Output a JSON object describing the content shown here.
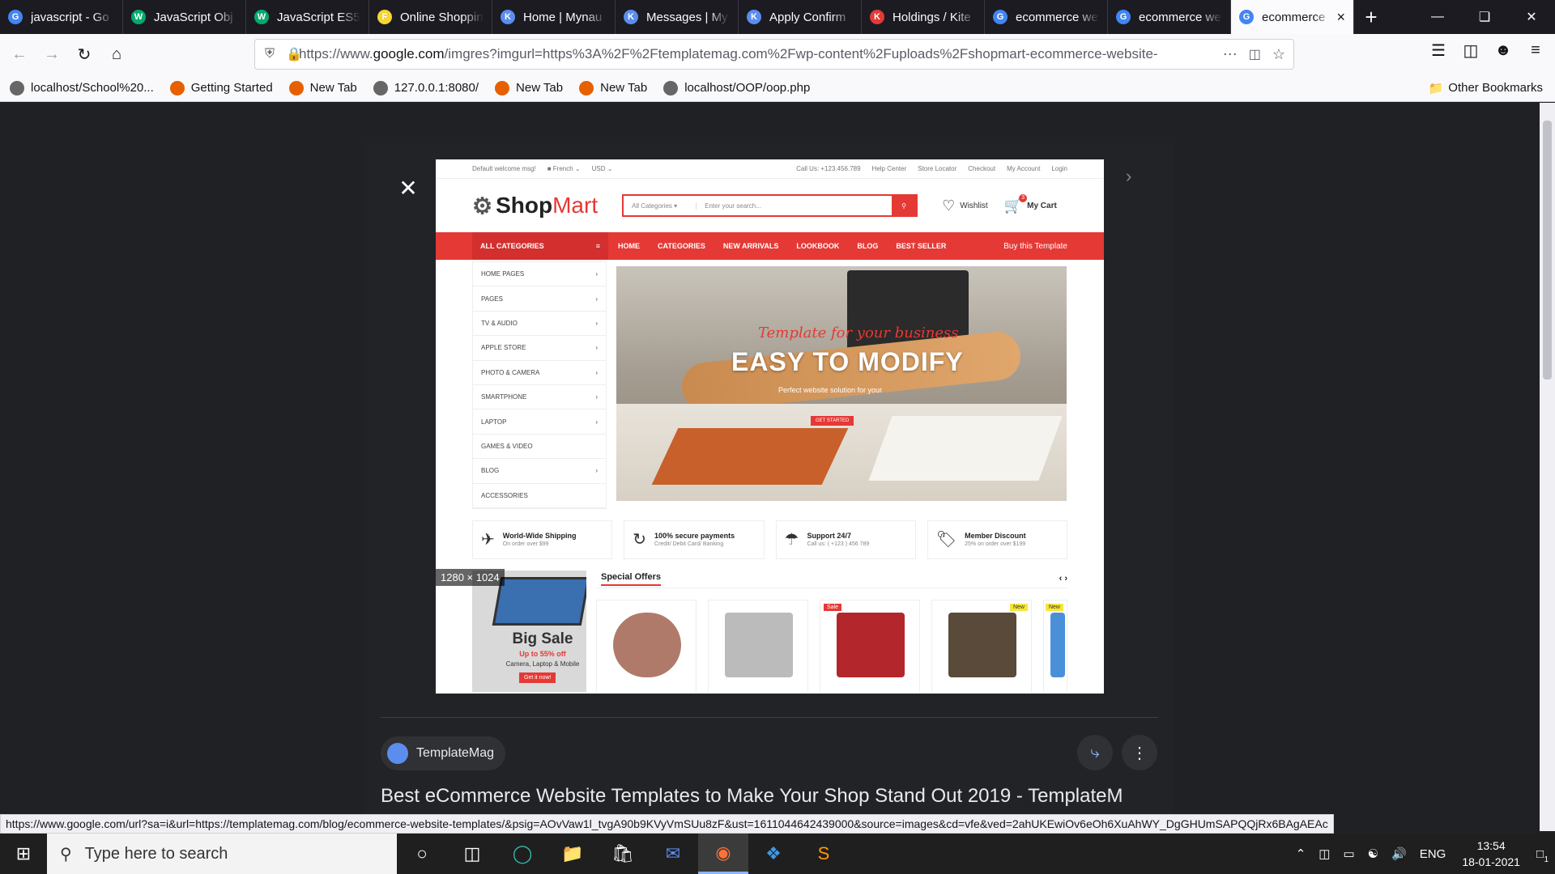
{
  "tabs": [
    {
      "title": "javascript - Go",
      "fav_color": "#4285f4",
      "fav_glyph": "G"
    },
    {
      "title": "JavaScript Obj",
      "fav_color": "#04aa6d",
      "fav_glyph": "W"
    },
    {
      "title": "JavaScript ES5",
      "fav_color": "#04aa6d",
      "fav_glyph": "W"
    },
    {
      "title": "Online Shoppin",
      "fav_color": "#f7d633",
      "fav_glyph": "F"
    },
    {
      "title": "Home | Mynau",
      "fav_color": "#5b8def",
      "fav_glyph": "K"
    },
    {
      "title": "Messages | My",
      "fav_color": "#5b8def",
      "fav_glyph": "K"
    },
    {
      "title": "Apply Confirm",
      "fav_color": "#5b8def",
      "fav_glyph": "K"
    },
    {
      "title": "Holdings / Kite",
      "fav_color": "#e53935",
      "fav_glyph": "K"
    },
    {
      "title": "ecommerce we",
      "fav_color": "#4285f4",
      "fav_glyph": "G"
    },
    {
      "title": "ecommerce we",
      "fav_color": "#4285f4",
      "fav_glyph": "G"
    },
    {
      "title": "ecommerce",
      "fav_color": "#4285f4",
      "fav_glyph": "G",
      "active": true
    }
  ],
  "url": {
    "prefix": "https://www.",
    "domain": "google.com",
    "rest": "/imgres?imgurl=https%3A%2F%2Ftemplatemag.com%2Fwp-content%2Fuploads%2Fshopmart-ecommerce-website-"
  },
  "bookmarks": [
    {
      "label": "localhost/School%20...",
      "color": "#666"
    },
    {
      "label": "Getting Started",
      "color": "#e66000"
    },
    {
      "label": "New Tab",
      "color": "#e66000"
    },
    {
      "label": "127.0.0.1:8080/",
      "color": "#666"
    },
    {
      "label": "New Tab",
      "color": "#e66000"
    },
    {
      "label": "New Tab",
      "color": "#e66000"
    },
    {
      "label": "localhost/OOP/oop.php",
      "color": "#666"
    }
  ],
  "other_bookmarks": "Other Bookmarks",
  "shop": {
    "welcome": "Default welcome msg!",
    "lang": "French",
    "currency": "USD",
    "call": "Call Us: +123.456.789",
    "top_links": [
      "Help Center",
      "Store Locator",
      "Checkout",
      "My Account",
      "Login"
    ],
    "logo_a": "Shop",
    "logo_b": "Mart",
    "all_categories": "All Categories",
    "search_placeholder": "Enter your search...",
    "wishlist": "Wishlist",
    "cart": "My Cart",
    "cart_count": "3",
    "nav_all": "ALL CATEGORIES",
    "nav_links": [
      "HOME",
      "CATEGORIES",
      "NEW ARRIVALS",
      "LOOKBOOK",
      "BLOG",
      "BEST SELLER"
    ],
    "buy": "Buy this Template",
    "categories": [
      "HOME PAGES",
      "PAGES",
      "TV & AUDIO",
      "APPLE STORE",
      "PHOTO & CAMERA",
      "SMARTPHONE",
      "LAPTOP",
      "GAMES & VIDEO",
      "BLOG",
      "ACCESSORIES"
    ],
    "hero_script": "Template for your business",
    "hero_title": "EASY TO MODIFY",
    "hero_sub": "Perfect website solution for your",
    "hero_btn": "GET STARTED",
    "features": [
      {
        "title": "World-Wide Shipping",
        "sub": "On order over $99",
        "icon": "✈"
      },
      {
        "title": "100% secure payments",
        "sub": "Credit/ Debit Card/ Banking",
        "icon": "↻"
      },
      {
        "title": "Support 24/7",
        "sub": "Call us: ( +123 ) 456 789",
        "icon": "☂"
      },
      {
        "title": "Member Discount",
        "sub": "25% on order over $199",
        "icon": "🏷"
      }
    ],
    "big_sale": "Big Sale",
    "sale_off": "Up to 55% off",
    "sale_cat": "Camera, Laptop & Mobile",
    "sale_btn": "Get it now!",
    "special_offers": "Special Offers",
    "prod_tags": [
      "",
      "",
      "",
      "Sale",
      "New",
      "New"
    ]
  },
  "dimensions": "1280 × 1024",
  "source": "TemplateMag",
  "result_title": "Best eCommerce Website Templates to Make Your Shop Stand Out 2019 - TemplateM",
  "status_url": "https://www.google.com/url?sa=i&url=https://templatemag.com/blog/ecommerce-website-templates/&psig=AOvVaw1l_tvgA90b9KVyVmSUu8zF&ust=1611044642439000&source=images&cd=vfe&ved=2ahUKEwiOv6eOh6XuAhWY_DgGHUmSAPQQjRx6BAgAEAc",
  "taskbar": {
    "search_placeholder": "Type here to search",
    "lang": "ENG",
    "time": "13:54",
    "date": "18-01-2021",
    "notif_count": "1"
  }
}
